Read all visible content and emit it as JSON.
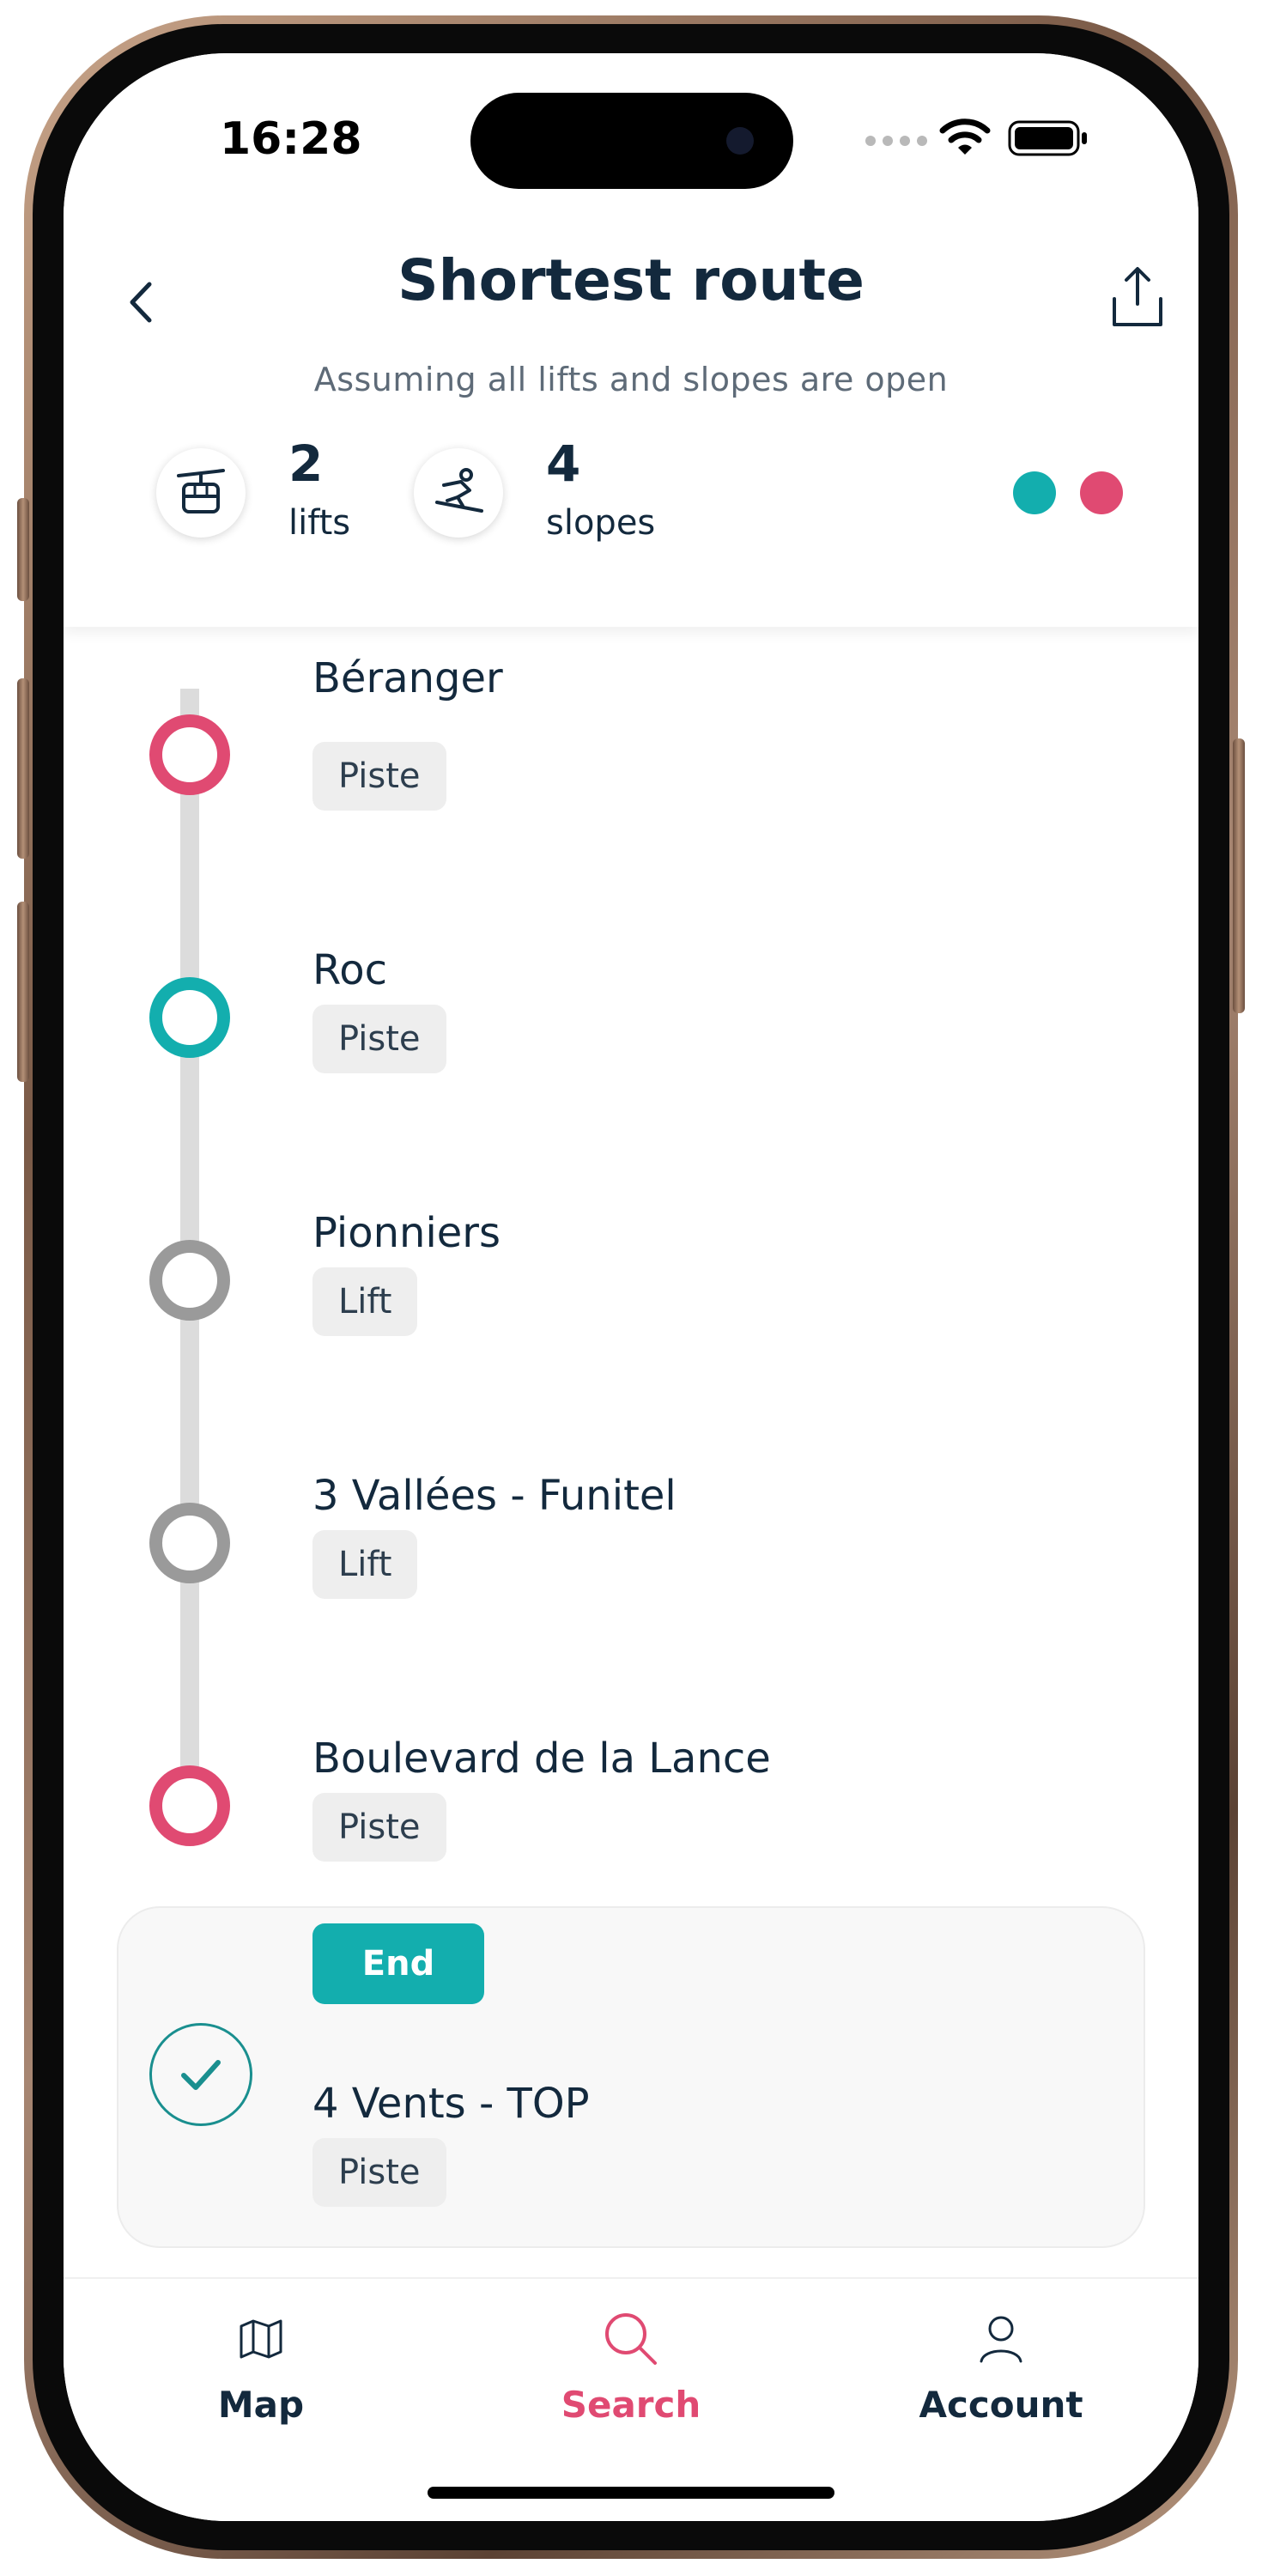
{
  "status_bar": {
    "time": "16:28"
  },
  "header": {
    "title": "Shortest route",
    "subtitle": "Assuming all lifts and slopes are open",
    "back_icon": "chevron-left-icon",
    "share_icon": "share-icon"
  },
  "stats": {
    "lifts": {
      "count": "2",
      "label": "lifts",
      "icon": "gondola-icon"
    },
    "slopes": {
      "count": "4",
      "label": "slopes",
      "icon": "skier-icon"
    },
    "legend_colors": [
      "#13aeae",
      "#e04a72"
    ]
  },
  "route": {
    "items": [
      {
        "name": "Béranger",
        "tag": "Piste",
        "color": "#e04a72"
      },
      {
        "name": "Roc",
        "tag": "Piste",
        "color": "#13aeae"
      },
      {
        "name": "Pionniers",
        "tag": "Lift",
        "color": "#9a9a9a"
      },
      {
        "name": "3 Vallées - Funitel",
        "tag": "Lift",
        "color": "#9a9a9a"
      },
      {
        "name": "Boulevard de la Lance",
        "tag": "Piste",
        "color": "#e04a72"
      }
    ],
    "end": {
      "badge": "End",
      "name": "4 Vents - TOP",
      "tag": "Piste"
    }
  },
  "tabbar": {
    "tabs": [
      {
        "label": "Map",
        "icon": "map-icon",
        "active": false
      },
      {
        "label": "Search",
        "icon": "search-icon",
        "active": true
      },
      {
        "label": "Account",
        "icon": "account-icon",
        "active": false
      }
    ],
    "active_color": "#e04a72"
  }
}
